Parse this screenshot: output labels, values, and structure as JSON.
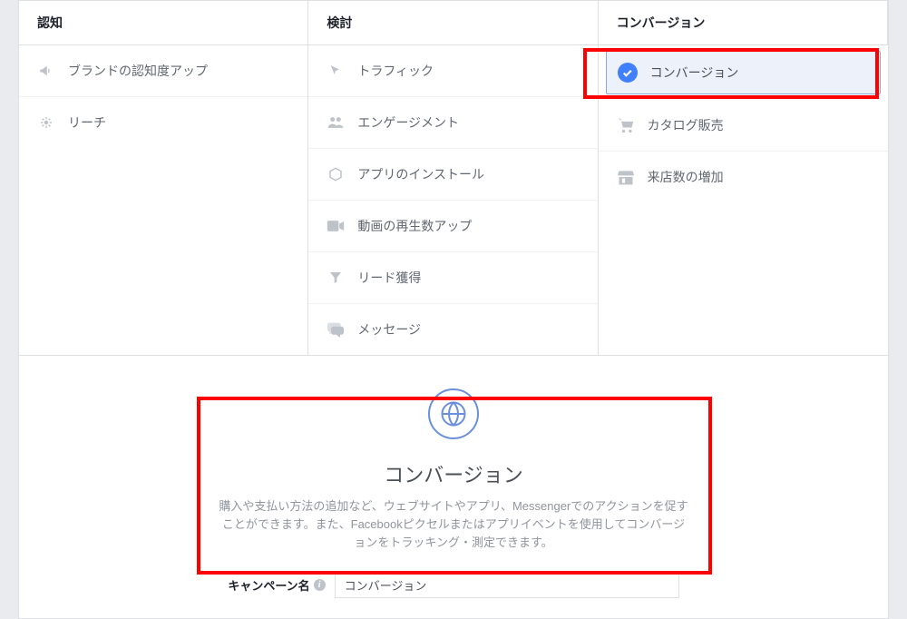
{
  "columns": {
    "awareness": {
      "title": "認知",
      "items": [
        {
          "label": "ブランドの認知度アップ"
        },
        {
          "label": "リーチ"
        }
      ]
    },
    "consideration": {
      "title": "検討",
      "items": [
        {
          "label": "トラフィック"
        },
        {
          "label": "エンゲージメント"
        },
        {
          "label": "アプリのインストール"
        },
        {
          "label": "動画の再生数アップ"
        },
        {
          "label": "リード獲得"
        },
        {
          "label": "メッセージ"
        }
      ]
    },
    "conversion": {
      "title": "コンバージョン",
      "items": [
        {
          "label": "コンバージョン",
          "selected": true
        },
        {
          "label": "カタログ販売"
        },
        {
          "label": "来店数の増加"
        }
      ]
    }
  },
  "detail": {
    "title": "コンバージョン",
    "description": "購入や支払い方法の追加など、ウェブサイトやアプリ、Messengerでのアクションを促すことができます。また、Facebookピクセルまたはアプリイベントを使用してコンバージョンをトラッキング・測定できます。"
  },
  "campaign": {
    "label": "キャンペーン名",
    "value": "コンバージョン"
  },
  "colors": {
    "accent": "#4080ff",
    "highlight": "#ff0000"
  }
}
